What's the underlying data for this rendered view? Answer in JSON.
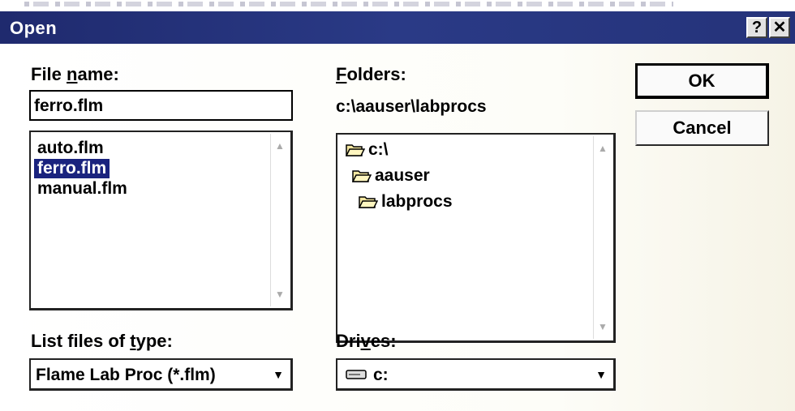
{
  "window": {
    "title": "Open",
    "help_label": "?",
    "close_label": "✕"
  },
  "file_name": {
    "label_pre": "File ",
    "label_accel": "n",
    "label_post": "ame:",
    "value": "ferro.flm",
    "files": [
      "auto.flm",
      "ferro.flm",
      "manual.flm"
    ],
    "selected_index": 1
  },
  "folders": {
    "label_accel": "F",
    "label_post": "olders:",
    "current_path": "c:\\aauser\\labprocs",
    "tree": [
      "c:\\",
      "aauser",
      "labprocs"
    ]
  },
  "buttons": {
    "ok": "OK",
    "cancel": "Cancel"
  },
  "file_type": {
    "label_pre": "List files of ",
    "label_accel": "t",
    "label_post": "ype:",
    "value": "Flame Lab Proc (*.flm)"
  },
  "drives": {
    "label_pre": "Dri",
    "label_accel": "v",
    "label_post": "es:",
    "value": "c:"
  },
  "icons": {
    "folder": "folder-open-icon",
    "drive": "hard-drive-icon",
    "dropdown": "chevron-down-icon"
  }
}
